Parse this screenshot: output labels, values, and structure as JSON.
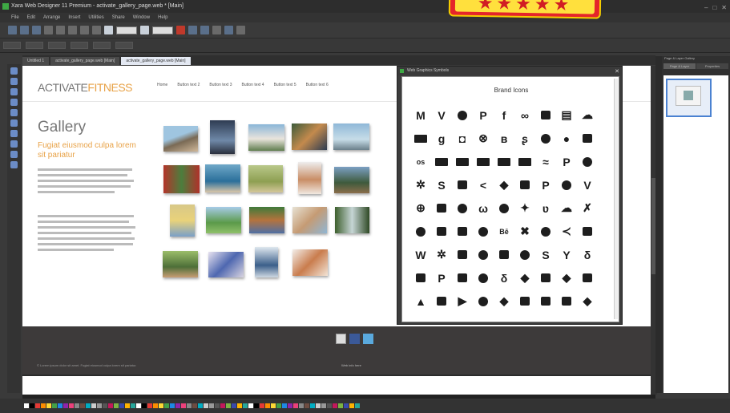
{
  "window": {
    "title": "Xara Web Designer 11 Premium - activate_gallery_page.web * [Main]"
  },
  "menu": [
    "File",
    "Edit",
    "Arrange",
    "Insert",
    "Utilities",
    "Share",
    "Window",
    "Help"
  ],
  "tabs": [
    {
      "label": "Untitled 1"
    },
    {
      "label": "activate_gallery_page.web [Main]"
    },
    {
      "label": "activate_gallery_page.web [Main]"
    }
  ],
  "site": {
    "logo_part1": "ACTIVATE",
    "logo_part2": "FITNESS",
    "nav": [
      "Home",
      "Button text 2",
      "Button text 3",
      "Button text 4",
      "Button text 5",
      "Button text 6"
    ],
    "gallery_title": "Gallery",
    "subhead": "Fugiat eiusmod culpa lorem sit pariatur",
    "footer_text": "© Lorem ipsum dolor sit amet. Fugiat eiusmod culpa lorem sit pariatur.",
    "footer_right": "Web info here"
  },
  "panel": {
    "title": "Web Graphics Symbols",
    "heading": "Brand Icons",
    "icons": [
      "gmail-icon",
      "vine-icon",
      "whatsapp-icon",
      "pinterest-icon",
      "facebook-square-icon",
      "lastfm-icon",
      "myspace-icon",
      "tumblr-square-icon",
      "soundcloud-icon",
      "blogger-icon",
      "google-icon",
      "delicious-icon",
      "dribbble-icon",
      "behance-square-icon",
      "sf-icon",
      "instagram-icon",
      "flickr-icon",
      "reddit-icon",
      "lastfm-square-icon",
      "card-amex-icon",
      "card-visa-icon",
      "card-paypal-icon",
      "card-mastercard-icon",
      "card-discover-icon",
      "rss-wifi-icon",
      "paypal-icon",
      "lastfm-round-icon",
      "yelp-icon",
      "skype-icon",
      "steam-icon",
      "share-alt-icon",
      "digg-icon",
      "git-icon",
      "foursquare-icon",
      "tripadvisor-icon",
      "vimeo-square-icon",
      "github-icon",
      "windows-icon",
      "pied-piper-icon",
      "drupal-icon",
      "stumbleupon-icon",
      "joomla-icon",
      "pinterest-p-icon",
      "bitbucket-icon",
      "xing-icon",
      "vine-square-icon",
      "slack-icon",
      "soundcloud-wave-icon",
      "yahoo-icon",
      "behance-icon",
      "dropbox-icon",
      "codepen-icon",
      "jsfiddle-icon",
      "xing-square-icon",
      "flickr-square-icon",
      "wordpress-icon",
      "spotify-icon",
      "openid-icon",
      "yahoo-square-icon",
      "sina-weibo-icon",
      "steam-square-icon",
      "hacker-news-icon",
      "vk-icon",
      "ocd-icon",
      "opera-icon",
      "tumblr-icon",
      "qq-icon",
      "linkedin-icon",
      "google-plus-icon",
      "stack-exchange-icon",
      "apple-icon",
      "dribbble-square-icon",
      "android-icon",
      "renren-icon",
      "youtube-icon",
      "empire-icon",
      "rebel-icon",
      "weixin-icon",
      "digg-square-icon",
      "git-square-icon",
      "vimeo-icon"
    ],
    "glyphs": [
      "M",
      "V",
      "◎",
      "P",
      "f",
      "∞",
      "▣",
      "▤",
      "☁",
      "▬",
      "g",
      "◘",
      "⊗",
      "ʙ",
      "ʂ",
      "◉",
      "●",
      "◙",
      "os",
      "▬",
      "▬",
      "▬",
      "▬",
      "▬",
      "≈",
      "P",
      "◍",
      "✲",
      "S",
      "▣",
      "<",
      "◆",
      "◼",
      "P",
      "◉",
      "V",
      "⊕",
      "◼",
      "◈",
      "ω",
      "◍",
      "✦",
      "ʋ",
      "☁",
      "✗",
      "◍",
      "◩",
      "◼",
      "◎",
      "Bē",
      "✖",
      "◈",
      "≺",
      "◨",
      "W",
      "✲",
      "◙",
      "◉",
      "◼",
      "◎",
      "S",
      "Y",
      "δ",
      "▣",
      "P",
      "◼",
      "◉",
      "δ",
      "◆",
      "◼",
      "◆",
      "◙",
      "▲",
      "◼",
      "▶",
      "◉",
      "◆",
      "◼",
      "◼",
      "◼",
      "◆"
    ]
  },
  "right_panel": {
    "title": "Page & Layer Gallery",
    "tabs": [
      "Page & Layer",
      "Properties"
    ]
  },
  "colors": {
    "accent": "#e8a247",
    "footer": "#3d3a3a",
    "selection": "#4b82d1"
  },
  "badge": {
    "stars": "★★★★★"
  }
}
